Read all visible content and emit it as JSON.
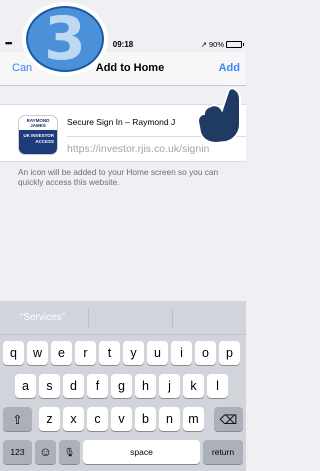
{
  "step_badge": "3",
  "status_bar": {
    "dots": "•••",
    "time": "09:18",
    "signal": "↗",
    "battery": "90%"
  },
  "navbar": {
    "cancel": "Can",
    "title": "Add to Home",
    "add": "Add"
  },
  "app_icon": {
    "top_text": "RAYMOND JAMES",
    "bottom_text": "UK INVESTOR ACCESS"
  },
  "card": {
    "name": "Secure Sign In – Raymond J",
    "url": "https://investor.rjis.co.uk/signin"
  },
  "helper_text": "An icon will be added to your Home screen so you can quickly access this website.",
  "keyboard": {
    "suggestion": "“Services”",
    "row1": [
      "q",
      "w",
      "e",
      "r",
      "t",
      "y",
      "u",
      "i",
      "o",
      "p"
    ],
    "row2": [
      "a",
      "s",
      "d",
      "f",
      "g",
      "h",
      "j",
      "k",
      "l"
    ],
    "row3": [
      "z",
      "x",
      "c",
      "v",
      "b",
      "n",
      "m"
    ],
    "shift": "⇧",
    "backspace": "⌫",
    "numbers": "123",
    "emoji": "☺",
    "mic": "🎙",
    "space": "space",
    "return": "return"
  }
}
